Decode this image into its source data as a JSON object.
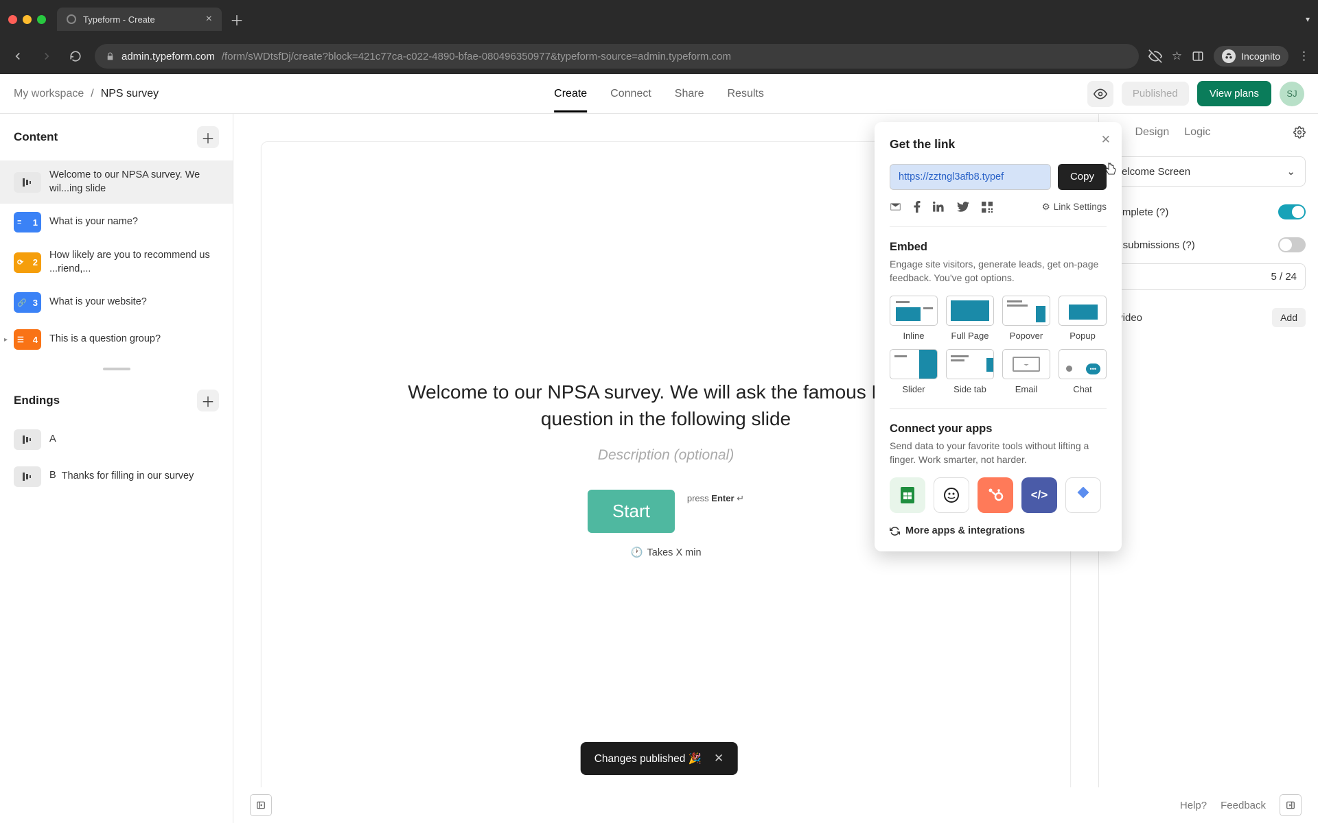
{
  "browser": {
    "tab_title": "Typeform - Create",
    "url_domain": "admin.typeform.com",
    "url_path": "/form/sWDtsfDj/create?block=421c77ca-c022-4890-bfae-080496350977&typeform-source=admin.typeform.com",
    "incognito": "Incognito"
  },
  "header": {
    "workspace": "My workspace",
    "form_name": "NPS survey",
    "tabs": {
      "create": "Create",
      "connect": "Connect",
      "share": "Share",
      "results": "Results"
    },
    "published": "Published",
    "view_plans": "View plans",
    "avatar_initials": "SJ"
  },
  "sidebar": {
    "content_title": "Content",
    "items": [
      {
        "label": "Welcome to our NPSA survey. We wil...ing slide"
      },
      {
        "num": "1",
        "label": "What is your name?"
      },
      {
        "num": "2",
        "label": "How likely are you to recommend us ...riend,..."
      },
      {
        "num": "3",
        "label": "What is your website?"
      },
      {
        "num": "4",
        "label": "This is a question group?"
      }
    ],
    "endings_title": "Endings",
    "endings": [
      {
        "letter": "A",
        "label": ""
      },
      {
        "letter": "B",
        "label": "Thanks for filling in our survey"
      }
    ]
  },
  "canvas": {
    "welcome_text": "Welcome to our NPSA survey. We will ask the famous NPSA question in the following slide",
    "description_placeholder": "Description (optional)",
    "start": "Start",
    "press": "press",
    "enter": "Enter",
    "enter_symbol": "↵",
    "takes": "Takes X min"
  },
  "right_panel": {
    "tabs": {
      "design": "Design",
      "logic": "Logic"
    },
    "question_type": "elcome Screen",
    "setting_complete": "complete (?)",
    "setting_submissions": "of submissions (?)",
    "counter": "5 / 24",
    "video_label": "r video",
    "add": "Add"
  },
  "popover": {
    "title": "Get the link",
    "link_value": "https://zztngl3afb8.typef",
    "copy": "Copy",
    "link_settings": "Link Settings",
    "embed_title": "Embed",
    "embed_desc": "Engage site visitors, generate leads, get on-page feedback. You've got options.",
    "embed_options": {
      "inline": "Inline",
      "full": "Full Page",
      "popover": "Popover",
      "popup": "Popup",
      "slider": "Slider",
      "sidetab": "Side tab",
      "email": "Email",
      "chat": "Chat"
    },
    "connect_title": "Connect your apps",
    "connect_desc": "Send data to your favorite tools without lifting a finger. Work smarter, not harder.",
    "more_apps": "More apps & integrations"
  },
  "toast": {
    "message": "Changes published 🎉"
  },
  "footer": {
    "help": "Help?",
    "feedback": "Feedback"
  }
}
